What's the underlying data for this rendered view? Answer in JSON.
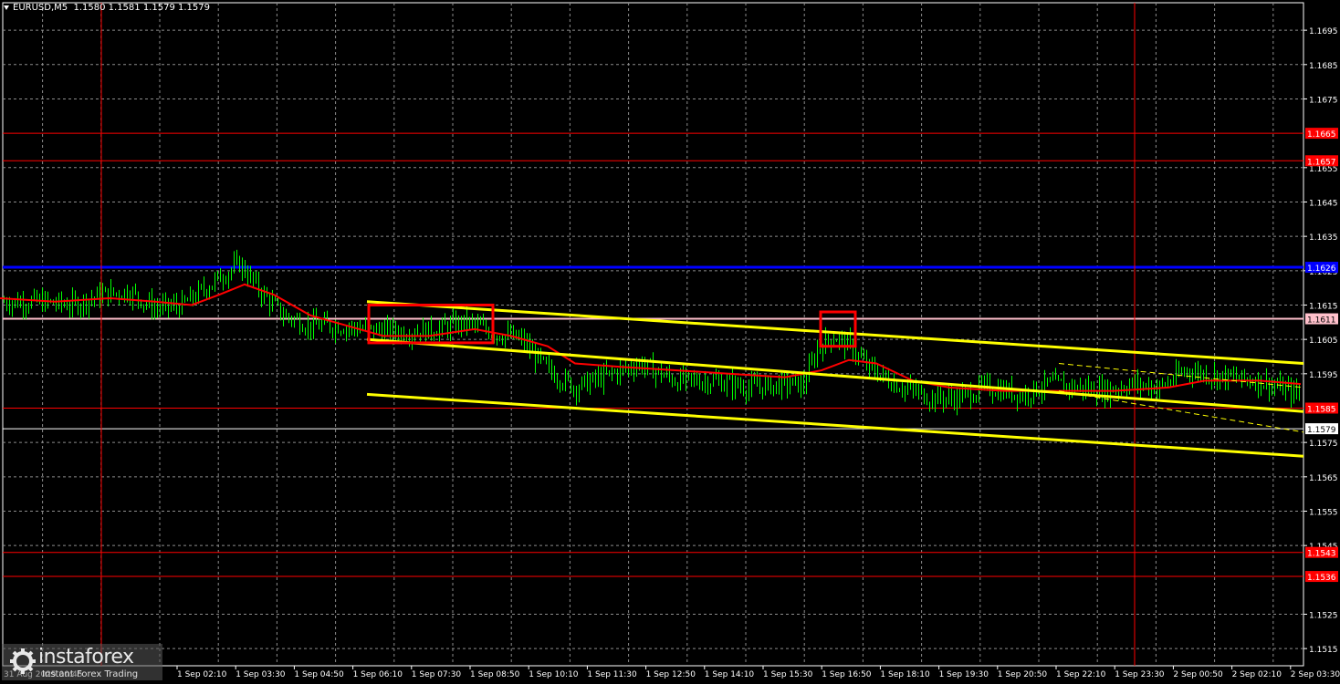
{
  "header": {
    "symbol": "EURUSD,M5",
    "ohlc": "1.1580 1.1581 1.1579 1.1579"
  },
  "watermark": {
    "brand": "instaforex",
    "tagline": "Instant Forex Trading",
    "icon": "instaforex-logo-icon"
  },
  "colors": {
    "background": "#000000",
    "grid": "#8c8c8c",
    "candles": "#00ff00",
    "moving_average": "#ff0000",
    "channel": "#ffff00",
    "level_red": "#ff0000",
    "level_blue": "#0000ff",
    "level_pink": "#ffc0cb",
    "level_gray": "#b0b8d0",
    "session_line": "#ff0000",
    "signal_box": "#ff0000"
  },
  "chart_data": {
    "type": "candlestick",
    "symbol": "EURUSD",
    "timeframe": "M5",
    "ylim": [
      1.151,
      1.1703
    ],
    "y_ticks": [
      "1.1695",
      "1.1685",
      "1.1675",
      "1.1655",
      "1.1645",
      "1.1635",
      "1.1625",
      "1.1615",
      "1.1605",
      "1.1595",
      "1.1575",
      "1.1565",
      "1.1555",
      "1.1545",
      "1.1525",
      "1.1515"
    ],
    "x_labels": [
      "1 Sep 02:10",
      "1 Sep 03:30",
      "1 Sep 04:50",
      "1 Sep 06:10",
      "1 Sep 07:30",
      "1 Sep 08:50",
      "1 Sep 10:10",
      "1 Sep 11:30",
      "1 Sep 12:50",
      "1 Sep 14:10",
      "1 Sep 15:30",
      "1 Sep 16:50",
      "1 Sep 18:10",
      "1 Sep 19:30",
      "1 Sep 20:50",
      "1 Sep 22:10",
      "1 Sep 23:30",
      "2 Sep 00:50",
      "2 Sep 02:10",
      "2 Sep 03:30"
    ],
    "x_label_first_partial": "31 Aug 2025 00:45",
    "price_path": [
      [
        0,
        1.1616
      ],
      [
        40,
        1.1616
      ],
      [
        80,
        1.1615
      ],
      [
        110,
        1.1618
      ],
      [
        140,
        1.1619
      ],
      [
        170,
        1.1614
      ],
      [
        200,
        1.1615
      ],
      [
        240,
        1.1623
      ],
      [
        262,
        1.1627
      ],
      [
        285,
        1.1619
      ],
      [
        310,
        1.1612
      ],
      [
        340,
        1.1609
      ],
      [
        370,
        1.1609
      ],
      [
        400,
        1.1608
      ],
      [
        440,
        1.1607
      ],
      [
        480,
        1.1608
      ],
      [
        510,
        1.161
      ],
      [
        540,
        1.1607
      ],
      [
        570,
        1.1605
      ],
      [
        600,
        1.1596
      ],
      [
        630,
        1.1591
      ],
      [
        660,
        1.1594
      ],
      [
        700,
        1.1598
      ],
      [
        740,
        1.1593
      ],
      [
        780,
        1.1593
      ],
      [
        820,
        1.1591
      ],
      [
        860,
        1.1592
      ],
      [
        880,
        1.1592
      ],
      [
        895,
        1.1602
      ],
      [
        912,
        1.1606
      ],
      [
        930,
        1.1603
      ],
      [
        950,
        1.1597
      ],
      [
        980,
        1.1592
      ],
      [
        1020,
        1.1588
      ],
      [
        1050,
        1.1588
      ],
      [
        1080,
        1.1591
      ],
      [
        1120,
        1.1589
      ],
      [
        1150,
        1.1592
      ],
      [
        1180,
        1.1591
      ],
      [
        1210,
        1.159
      ],
      [
        1240,
        1.1592
      ],
      [
        1270,
        1.1591
      ],
      [
        1300,
        1.1596
      ],
      [
        1340,
        1.1594
      ],
      [
        1380,
        1.1593
      ],
      [
        1410,
        1.159
      ],
      [
        1425,
        1.1589
      ]
    ],
    "moving_average": [
      [
        0,
        1.1617
      ],
      [
        60,
        1.1616
      ],
      [
        120,
        1.1617
      ],
      [
        170,
        1.1616
      ],
      [
        210,
        1.1615
      ],
      [
        240,
        1.1618
      ],
      [
        268,
        1.1621
      ],
      [
        300,
        1.1618
      ],
      [
        340,
        1.1612
      ],
      [
        380,
        1.1609
      ],
      [
        420,
        1.1606
      ],
      [
        470,
        1.1606
      ],
      [
        520,
        1.1608
      ],
      [
        560,
        1.1606
      ],
      [
        600,
        1.1603
      ],
      [
        630,
        1.1598
      ],
      [
        680,
        1.1597
      ],
      [
        740,
        1.1596
      ],
      [
        800,
        1.1595
      ],
      [
        860,
        1.1594
      ],
      [
        900,
        1.1596
      ],
      [
        930,
        1.1599
      ],
      [
        960,
        1.1598
      ],
      [
        1000,
        1.1593
      ],
      [
        1040,
        1.1591
      ],
      [
        1100,
        1.159
      ],
      [
        1160,
        1.159
      ],
      [
        1220,
        1.159
      ],
      [
        1280,
        1.1591
      ],
      [
        1320,
        1.1593
      ],
      [
        1380,
        1.1593
      ],
      [
        1425,
        1.1592
      ]
    ],
    "channel_lines": [
      {
        "from": [
          402,
          1.1616
        ],
        "to": [
          1428,
          1.1598
        ]
      },
      {
        "from": [
          402,
          1.1605
        ],
        "to": [
          1428,
          1.1584
        ]
      },
      {
        "from": [
          402,
          1.1589
        ],
        "to": [
          1428,
          1.1571
        ]
      }
    ],
    "channel_dashed": [
      {
        "from": [
          1160,
          1.1598
        ],
        "to": [
          1428,
          1.1591
        ]
      },
      {
        "from": [
          1160,
          1.159
        ],
        "to": [
          1428,
          1.1578
        ]
      }
    ],
    "signal_boxes": [
      {
        "x_from": 404,
        "x_to": 540,
        "y_from": 1.1615,
        "y_to": 1.1604
      },
      {
        "x_from": 899,
        "x_to": 937,
        "y_from": 1.1613,
        "y_to": 1.1603
      }
    ],
    "horizontal_levels": [
      {
        "price": 1.1665,
        "label": "1.1665",
        "color": "#ff0000"
      },
      {
        "price": 1.1657,
        "label": "1.1657",
        "color": "#ff0000"
      },
      {
        "price": 1.1626,
        "label": "1.1626",
        "color": "#0000ff"
      },
      {
        "price": 1.1611,
        "label": "1.1611",
        "color": "#ffc0cb"
      },
      {
        "price": 1.1585,
        "label": "1.1585",
        "color": "#ff0000"
      },
      {
        "price": 1.1579,
        "label": "1.1579",
        "color": "#ffffff"
      },
      {
        "price": 1.1543,
        "label": "1.1543",
        "color": "#ff0000"
      },
      {
        "price": 1.1536,
        "label": "1.1536",
        "color": "#ff0000"
      }
    ],
    "session_lines": [
      111,
      1243
    ]
  }
}
